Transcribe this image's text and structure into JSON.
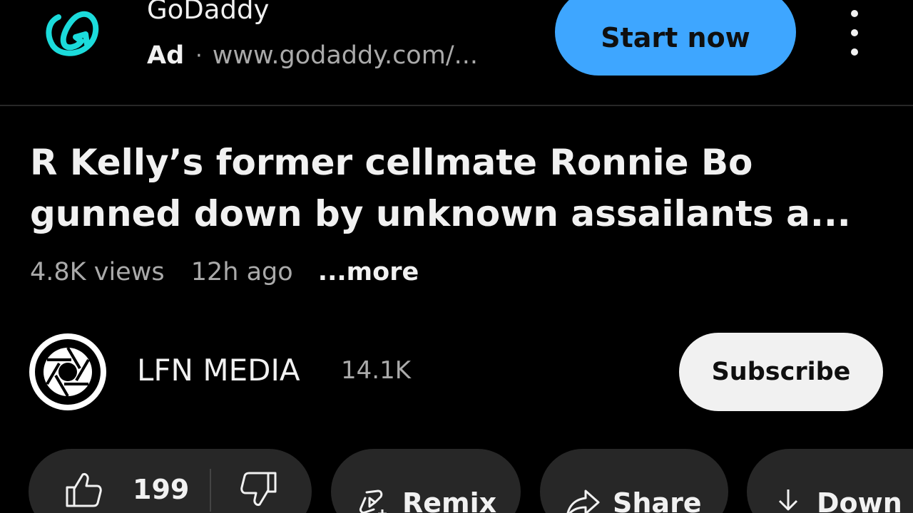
{
  "ad": {
    "advertiser": "GoDaddy",
    "badge": "Ad",
    "separator": "·",
    "url": "www.godaddy.com/...",
    "cta_label": "Start now",
    "logo_icon": "godaddy-logo",
    "menu_icon": "more-vertical-icon",
    "accent_color": "#3ea6ff",
    "logo_color": "#1bdbdb"
  },
  "video": {
    "title_line1": "R Kelly’s former cellmate Ronnie Bo",
    "title_line2": "gunned down by unknown assailants a...",
    "views": "4.8K views",
    "age": "12h ago",
    "more_label": "...more"
  },
  "channel": {
    "name": "LFN MEDIA",
    "subscribers": "14.1K",
    "subscribe_label": "Subscribe",
    "avatar_icon": "camera-aperture-icon"
  },
  "actions": {
    "like_count": "199",
    "like_icon": "thumbs-up-icon",
    "dislike_icon": "thumbs-down-icon",
    "remix_label": "Remix",
    "remix_icon": "remix-icon",
    "share_label": "Share",
    "share_icon": "share-arrow-icon",
    "download_label": "Down",
    "download_icon": "download-icon"
  },
  "colors": {
    "background": "#000000",
    "chip_background": "#272727",
    "primary_text": "#f1f1f1",
    "secondary_text": "#aaaaaa"
  }
}
